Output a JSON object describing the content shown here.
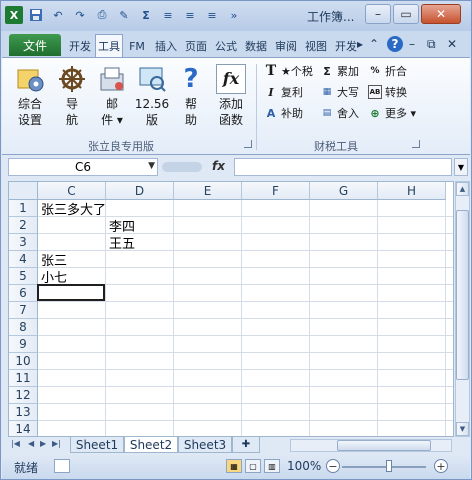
{
  "window": {
    "title": "工作簿..."
  },
  "ribbon_tabs": {
    "file": "文件",
    "tabs": [
      "开发",
      "工具",
      "FM",
      "插入",
      "页面",
      "公式",
      "数据",
      "审阅",
      "视图",
      "开发"
    ]
  },
  "ribbon": {
    "group1": {
      "label": "张立良专用版",
      "buttons": [
        {
          "line1": "综合",
          "line2": "设置"
        },
        {
          "line1": "导",
          "line2": "航"
        },
        {
          "line1": "邮",
          "line2": "件 ▾"
        },
        {
          "line1": "12.56",
          "line2": "版"
        },
        {
          "line1": "帮",
          "line2": "助"
        },
        {
          "line1": "添加",
          "line2": "函数"
        }
      ]
    },
    "group2": {
      "label": "财税工具",
      "small": [
        "★个税",
        "复利",
        "补助",
        "累加",
        "大写",
        "舍入",
        "折合",
        "转换",
        "更多 ▾"
      ]
    }
  },
  "formula_bar": {
    "name_box": "C6",
    "fx": "fx",
    "formula": ""
  },
  "grid": {
    "columns": [
      "C",
      "D",
      "E",
      "F",
      "G",
      "H"
    ],
    "rows": [
      "1",
      "2",
      "3",
      "4",
      "5",
      "6",
      "7",
      "8",
      "9",
      "10",
      "11",
      "12",
      "13",
      "14"
    ],
    "cells": {
      "C1": "张三多大了",
      "D2": "李四",
      "D3": "王五",
      "C4": "张三",
      "C5": "小七"
    }
  },
  "sheets": {
    "tabs": [
      "Sheet1",
      "Sheet2",
      "Sheet3"
    ],
    "active": "Sheet2"
  },
  "status": {
    "ready": "就绪",
    "zoom": "100%"
  },
  "colors": {
    "file_tab": "#1f6e2f",
    "accent": "#1e395b"
  }
}
